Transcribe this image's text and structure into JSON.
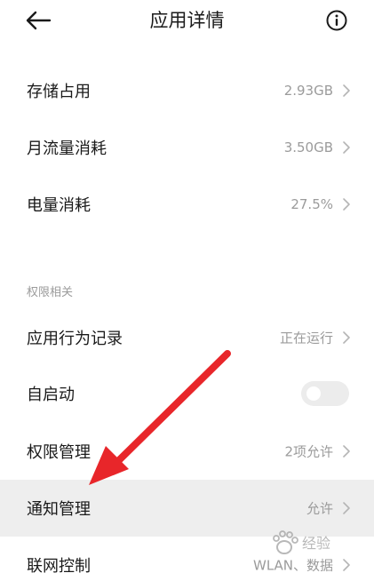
{
  "header": {
    "title": "应用详情"
  },
  "usage": [
    {
      "label": "存储占用",
      "value": "2.93GB"
    },
    {
      "label": "月流量消耗",
      "value": "3.50GB"
    },
    {
      "label": "电量消耗",
      "value": "27.5%"
    }
  ],
  "permissions": {
    "section_title": "权限相关",
    "items": [
      {
        "label": "应用行为记录",
        "value": "正在运行"
      },
      {
        "label": "自启动",
        "toggle_on": false
      },
      {
        "label": "权限管理",
        "value": "2项允许"
      },
      {
        "label": "通知管理",
        "value": "允许"
      },
      {
        "label": "联网控制",
        "value": "WLAN、数据"
      }
    ]
  },
  "colors": {
    "text": "#1a1a1a",
    "secondary": "#9b9b9b",
    "highlight_row": "#eeeeee",
    "annotation_arrow": "#e8262a"
  },
  "icons": {
    "back": "arrow-left-icon",
    "info": "info-circle-icon",
    "chevron": "chevron-right-icon"
  },
  "watermark": {
    "text": "经验"
  }
}
